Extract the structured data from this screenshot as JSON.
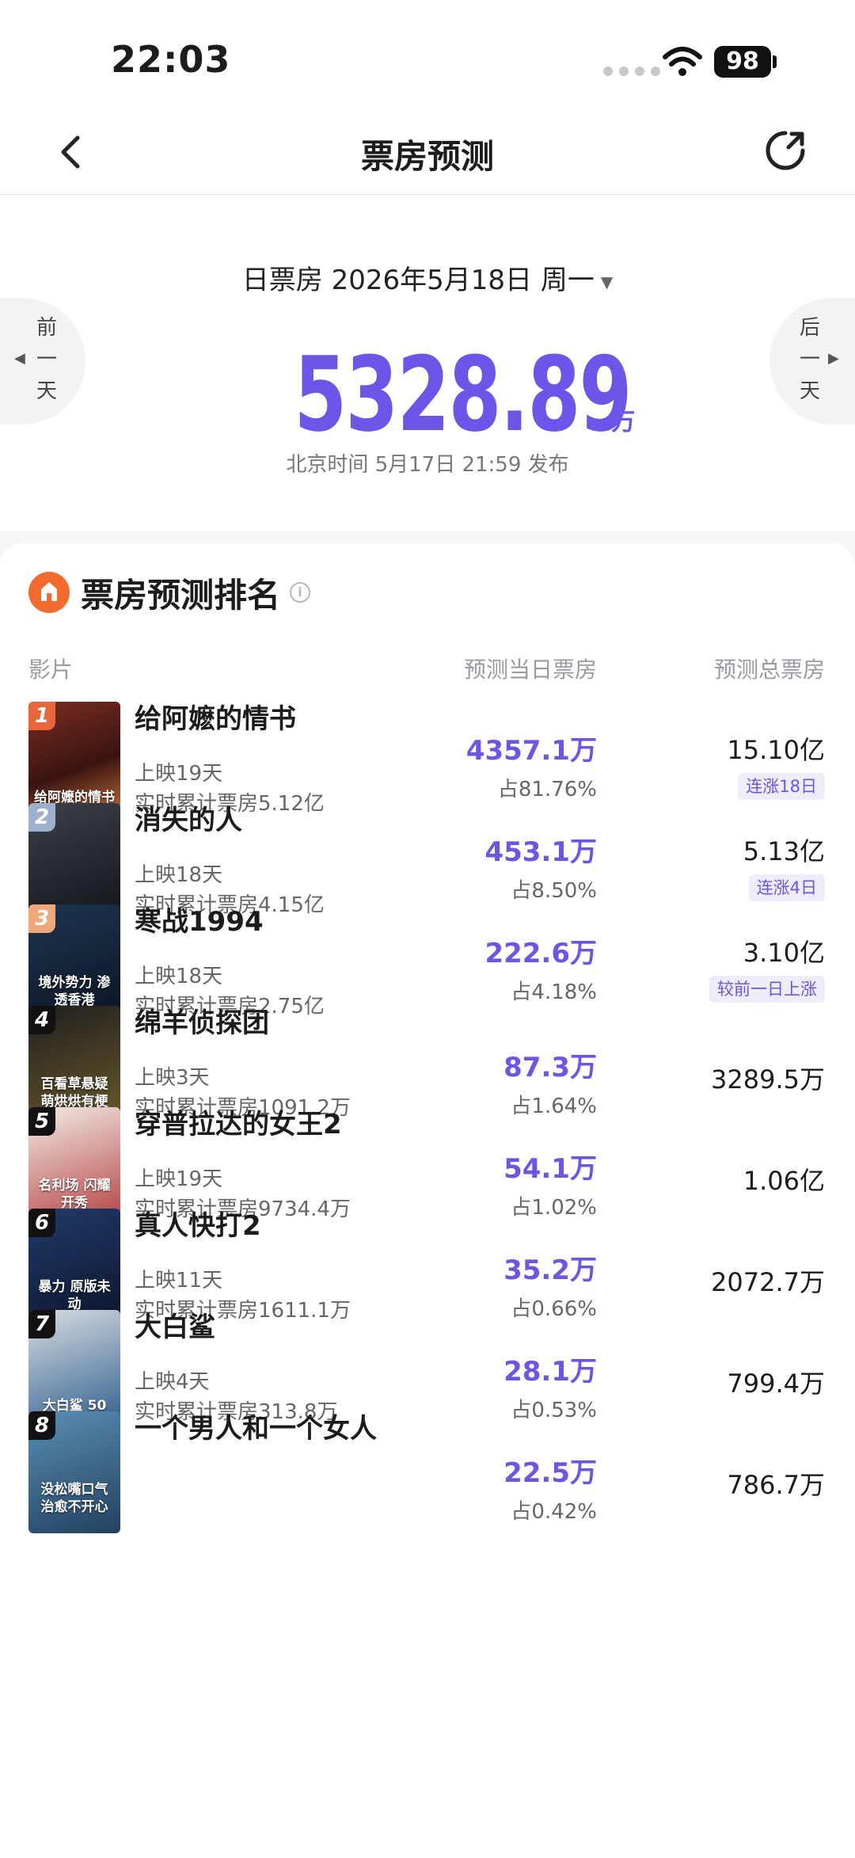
{
  "status": {
    "time": "22:03",
    "battery": "98"
  },
  "nav": {
    "title": "票房预测"
  },
  "summary": {
    "date": "日票房 2026年5月18日 周一",
    "total": "5328.89",
    "unit": "万",
    "publish": "北京时间 5月17日 21:59 发布",
    "prev_day": "前一天",
    "next_day": "后一天"
  },
  "ranking": {
    "title": "票房预测排名",
    "col_film": "影片",
    "col_day": "预测当日票房",
    "col_total": "预测总票房"
  },
  "films": [
    {
      "rank": "1",
      "name": "给阿嬷的情书",
      "days": "上映19天",
      "cum": "实时累计票房5.12亿",
      "day_pred": "4357.1万",
      "share": "占81.76%",
      "total": "15.10亿",
      "tag": "连涨18日",
      "poster_text": "给阿嬷的情书"
    },
    {
      "rank": "2",
      "name": "消失的人",
      "days": "上映18天",
      "cum": "实时累计票房4.15亿",
      "day_pred": "453.1万",
      "share": "占8.50%",
      "total": "5.13亿",
      "tag": "连涨4日",
      "poster_text": ""
    },
    {
      "rank": "3",
      "name": "寒战1994",
      "days": "上映18天",
      "cum": "实时累计票房2.75亿",
      "day_pred": "222.6万",
      "share": "占4.18%",
      "total": "3.10亿",
      "tag": "较前一日上涨",
      "poster_text": "境外势力 渗透香港"
    },
    {
      "rank": "4",
      "name": "绵羊侦探团",
      "days": "上映3天",
      "cum": "实时累计票房1091.2万",
      "day_pred": "87.3万",
      "share": "占1.64%",
      "total": "3289.5万",
      "tag": "",
      "poster_text": "百看草悬疑 萌烘烘有梗"
    },
    {
      "rank": "5",
      "name": "穿普拉达的女王2",
      "days": "上映19天",
      "cum": "实时累计票房9734.4万",
      "day_pred": "54.1万",
      "share": "占1.02%",
      "total": "1.06亿",
      "tag": "",
      "poster_text": "名利场 闪耀开秀"
    },
    {
      "rank": "6",
      "name": "真人快打2",
      "days": "上映11天",
      "cum": "实时累计票房1611.1万",
      "day_pred": "35.2万",
      "share": "占0.66%",
      "total": "2072.7万",
      "tag": "",
      "poster_text": "暴力 原版未动"
    },
    {
      "rank": "7",
      "name": "大白鲨",
      "days": "上映4天",
      "cum": "实时累计票房313.8万",
      "day_pred": "28.1万",
      "share": "占0.53%",
      "total": "799.4万",
      "tag": "",
      "poster_text": "大白鲨 50"
    },
    {
      "rank": "8",
      "name": "一个男人和一个女人",
      "days": "",
      "cum": "",
      "day_pred": "22.5万",
      "share": "占0.42%",
      "total": "786.7万",
      "tag": "",
      "poster_text": "没松嘴口气 治愈不开心"
    }
  ],
  "colors": {
    "accent": "#6c55e8",
    "logo": "#f26a2c",
    "badge_1": "#e8663a",
    "badge_2": "#9db1cf",
    "badge_3": "#f0a878",
    "badge_other": "#111111"
  }
}
